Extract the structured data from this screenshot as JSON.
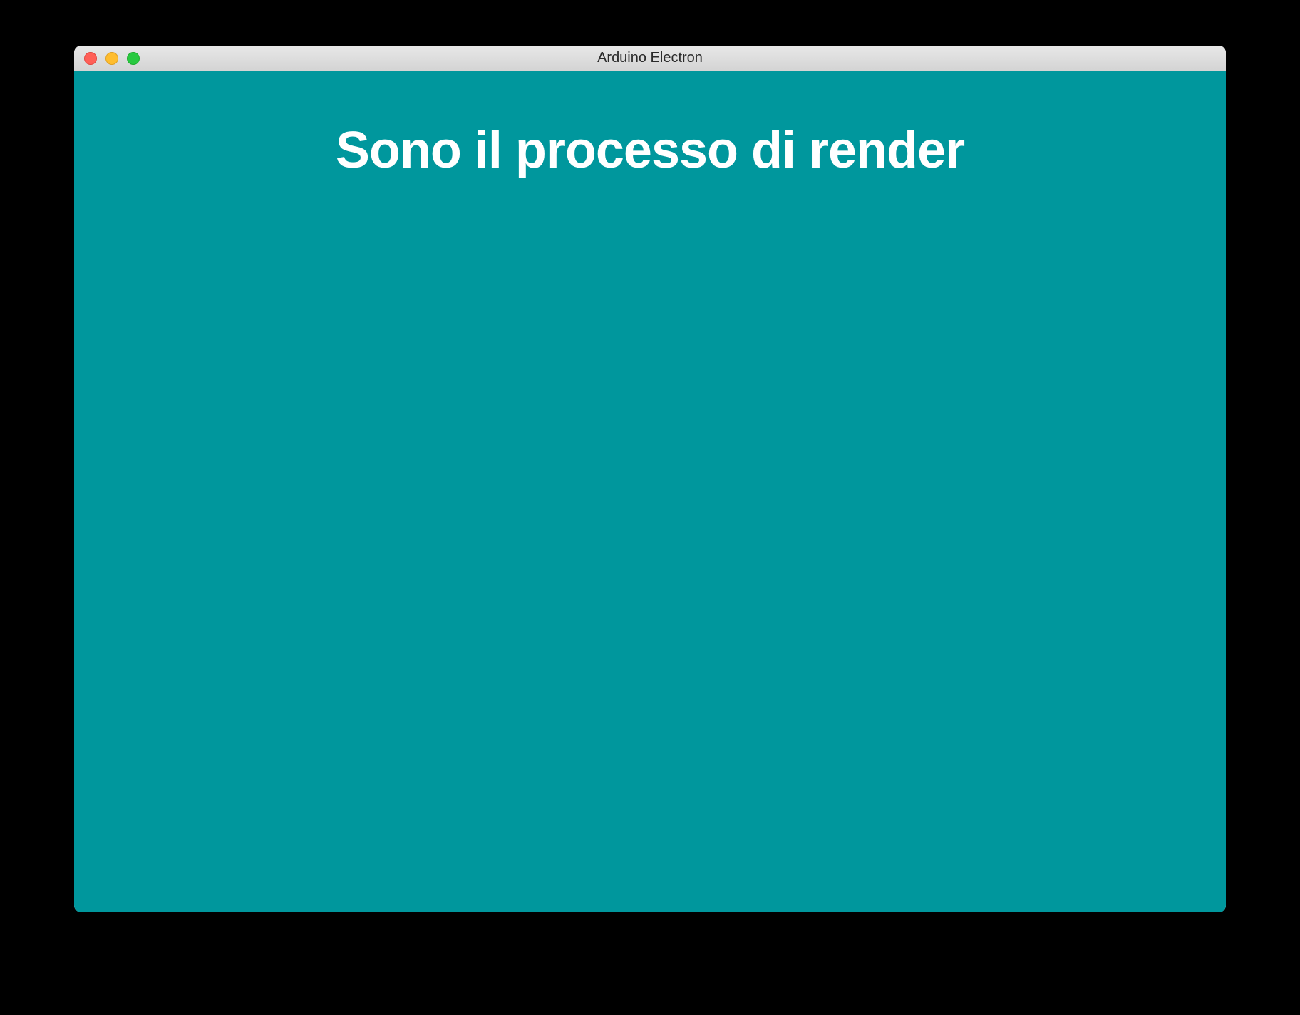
{
  "window": {
    "title": "Arduino Electron"
  },
  "content": {
    "heading": "Sono il processo di render"
  },
  "colors": {
    "background": "#00979d",
    "text": "#ffffff"
  }
}
